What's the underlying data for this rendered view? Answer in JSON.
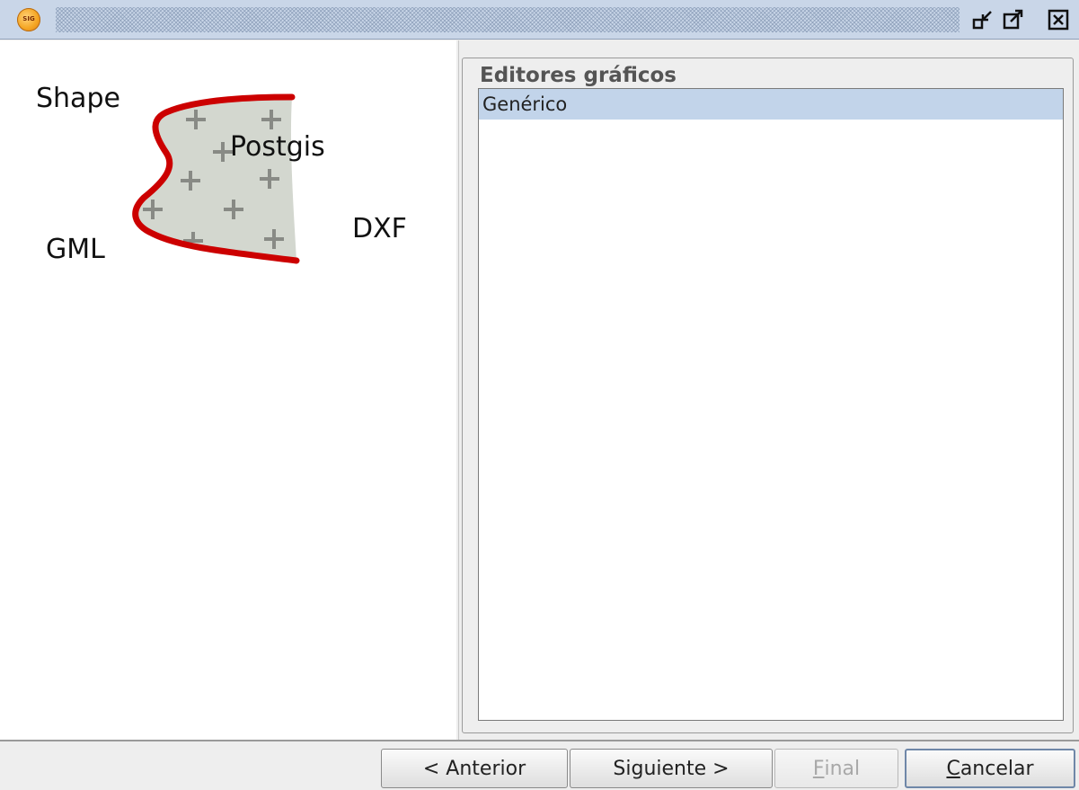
{
  "window": {
    "logo_text": "SIG"
  },
  "left_panel": {
    "labels": {
      "shape": "Shape",
      "postgis": "Postgis",
      "gml": "GML",
      "dxf": "DXF"
    }
  },
  "right_panel": {
    "group_title": "Editores gráficos",
    "list_items": [
      {
        "label": "Genérico",
        "selected": true
      }
    ]
  },
  "buttons": {
    "previous": "< Anterior",
    "next": "Siguiente >",
    "finish_mnemonic": "F",
    "finish_rest": "inal",
    "cancel_mnemonic": "C",
    "cancel_rest": "ancelar"
  },
  "colors": {
    "titlebar": "#c9d6e8",
    "selection": "#c2d4ea",
    "shape_outline": "#cc0000",
    "shape_fill": "#d3d7cf"
  },
  "icons": {
    "app": "sig-logo-icon",
    "minimize": "minimize-icon",
    "maximize": "maximize-icon",
    "close": "close-icon"
  }
}
